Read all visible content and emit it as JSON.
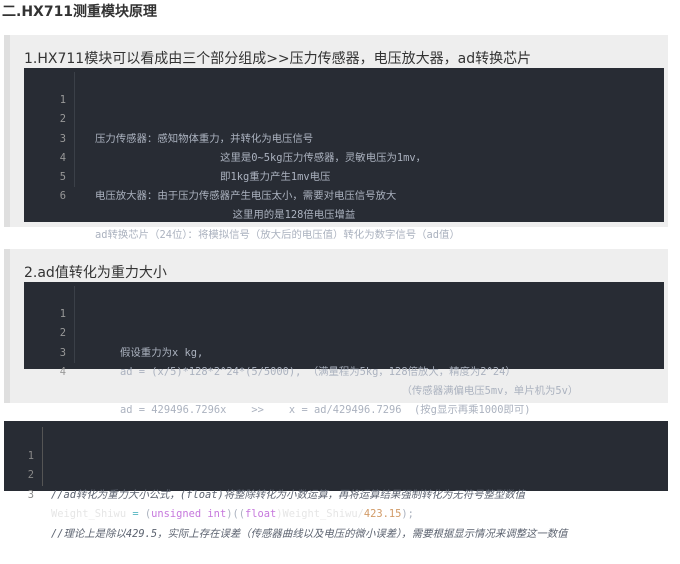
{
  "page_heading": "二.HX711测重模块原理",
  "section1": {
    "title": "1.HX711模块可以看成由三个部分组成>>压力传感器，电压放大器，ad转换芯片",
    "lines": [
      {
        "num": "1",
        "text": "压力传感器：感知物体重力，并转化为电压信号"
      },
      {
        "num": "2",
        "text": "                    这里是0~5kg压力传感器，灵敏电压为1mv，"
      },
      {
        "num": "3",
        "text": "                    即1kg重力产生1mv电压"
      },
      {
        "num": "4",
        "text": "电压放大器：由于压力传感器产生电压太小，需要对电压信号放大"
      },
      {
        "num": "5",
        "text": "                      这里用的是128倍电压增益"
      },
      {
        "num": "6",
        "text": "ad转换芯片（24位）：将模拟信号（放大后的电压值）转化为数字信号（ad值）"
      }
    ]
  },
  "section2": {
    "title": "2.ad值转化为重力大小",
    "lines": [
      {
        "num": "1",
        "text": "    假设重力为x kg,"
      },
      {
        "num": "2",
        "text": "    ad = (x/5)*128*2^24*(5/5000), （满量程为5kg，128倍放大，精度为2^24）"
      },
      {
        "num": "3",
        "text": "                                                 （传感器满偏电压5mv，单片机为5v）"
      },
      {
        "num": "4",
        "text": "    ad = 429496.7296x    >>    x = ad/429496.7296  (按g显示再乘1000即可)"
      }
    ]
  },
  "code3": {
    "line1": {
      "num": "1",
      "comment": "//ad转化为重力大小公式，(float)将整除转化为小数运算，再将运算结果强制转化为无符号整型数值"
    },
    "line2": {
      "num": "2",
      "var": "Weight_Shiwu",
      "eq": " = ",
      "open_paren": "(",
      "cast_type": "unsigned int",
      "close_mid": ")((",
      "float_kw": "float",
      "rest": ")Weight_Shiwu/",
      "divisor": "423.15",
      "end": ");"
    },
    "line3": {
      "num": "3",
      "comment": "//理论上是除以429.5，实际上存在误差（传感器曲线以及电压的微小误差），需要根据显示情况来调整这一数值"
    }
  }
}
